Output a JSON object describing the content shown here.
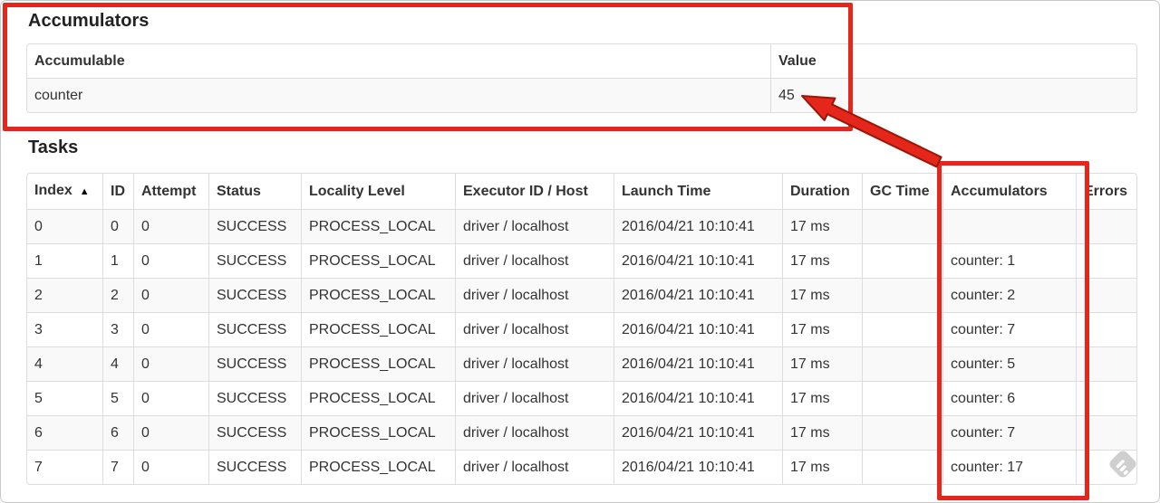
{
  "accumulators_section": {
    "title": "Accumulators",
    "table": {
      "headers": [
        "Accumulable",
        "Value"
      ],
      "column_keys": [
        "accumulable",
        "value"
      ],
      "rows": [
        {
          "accumulable": "counter",
          "value": "45"
        }
      ]
    }
  },
  "tasks_section": {
    "title": "Tasks",
    "table": {
      "headers": [
        "Index",
        "ID",
        "Attempt",
        "Status",
        "Locality Level",
        "Executor ID / Host",
        "Launch Time",
        "Duration",
        "GC Time",
        "Accumulators",
        "Errors"
      ],
      "column_keys": [
        "index",
        "id",
        "attempt",
        "status",
        "locality",
        "executor",
        "launch_time",
        "duration",
        "gc_time",
        "accumulators",
        "errors"
      ],
      "sorted_column": "Index",
      "rows": [
        {
          "index": "0",
          "id": "0",
          "attempt": "0",
          "status": "SUCCESS",
          "locality": "PROCESS_LOCAL",
          "executor": "driver / localhost",
          "launch_time": "2016/04/21 10:10:41",
          "duration": "17 ms",
          "gc_time": "",
          "accumulators": "",
          "errors": ""
        },
        {
          "index": "1",
          "id": "1",
          "attempt": "0",
          "status": "SUCCESS",
          "locality": "PROCESS_LOCAL",
          "executor": "driver / localhost",
          "launch_time": "2016/04/21 10:10:41",
          "duration": "17 ms",
          "gc_time": "",
          "accumulators": "counter: 1",
          "errors": ""
        },
        {
          "index": "2",
          "id": "2",
          "attempt": "0",
          "status": "SUCCESS",
          "locality": "PROCESS_LOCAL",
          "executor": "driver / localhost",
          "launch_time": "2016/04/21 10:10:41",
          "duration": "17 ms",
          "gc_time": "",
          "accumulators": "counter: 2",
          "errors": ""
        },
        {
          "index": "3",
          "id": "3",
          "attempt": "0",
          "status": "SUCCESS",
          "locality": "PROCESS_LOCAL",
          "executor": "driver / localhost",
          "launch_time": "2016/04/21 10:10:41",
          "duration": "17 ms",
          "gc_time": "",
          "accumulators": "counter: 7",
          "errors": ""
        },
        {
          "index": "4",
          "id": "4",
          "attempt": "0",
          "status": "SUCCESS",
          "locality": "PROCESS_LOCAL",
          "executor": "driver / localhost",
          "launch_time": "2016/04/21 10:10:41",
          "duration": "17 ms",
          "gc_time": "",
          "accumulators": "counter: 5",
          "errors": ""
        },
        {
          "index": "5",
          "id": "5",
          "attempt": "0",
          "status": "SUCCESS",
          "locality": "PROCESS_LOCAL",
          "executor": "driver / localhost",
          "launch_time": "2016/04/21 10:10:41",
          "duration": "17 ms",
          "gc_time": "",
          "accumulators": "counter: 6",
          "errors": ""
        },
        {
          "index": "6",
          "id": "6",
          "attempt": "0",
          "status": "SUCCESS",
          "locality": "PROCESS_LOCAL",
          "executor": "driver / localhost",
          "launch_time": "2016/04/21 10:10:41",
          "duration": "17 ms",
          "gc_time": "",
          "accumulators": "counter: 7",
          "errors": ""
        },
        {
          "index": "7",
          "id": "7",
          "attempt": "0",
          "status": "SUCCESS",
          "locality": "PROCESS_LOCAL",
          "executor": "driver / localhost",
          "launch_time": "2016/04/21 10:10:41",
          "duration": "17 ms",
          "gc_time": "",
          "accumulators": "counter: 17",
          "errors": ""
        }
      ]
    }
  },
  "icons": {
    "sort_ascending": "▲"
  },
  "annotations": {
    "highlight_color": "#e5261b",
    "arrow_outline_color": "#9c1507"
  }
}
